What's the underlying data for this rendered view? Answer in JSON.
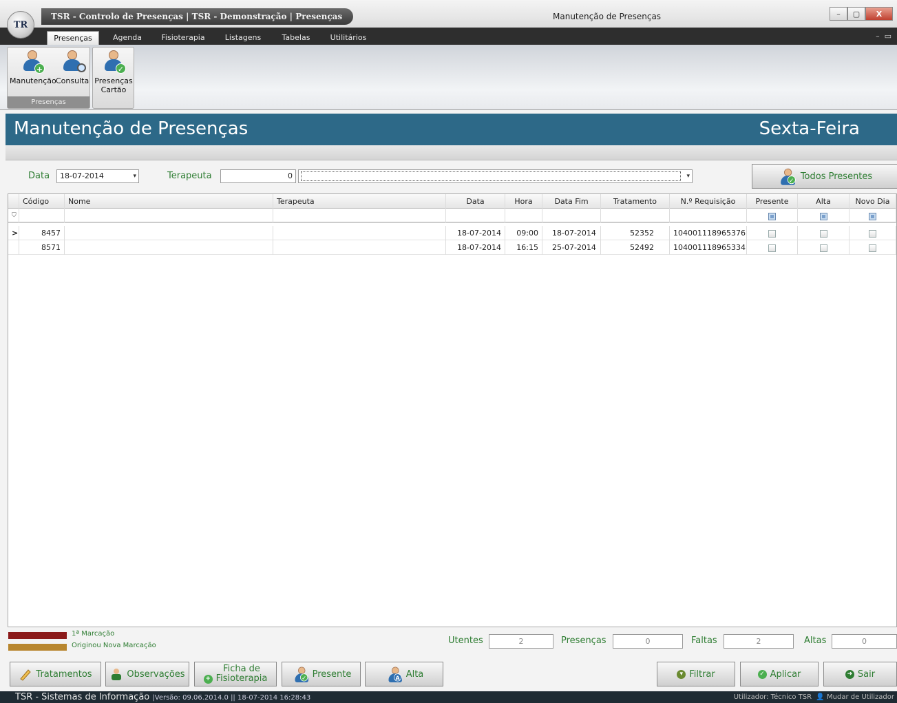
{
  "titlebar": {
    "logo": "TR",
    "app_title": "TSR - Controlo de Presenças  |  TSR - Demonstração  |  Presenças",
    "window_title": "Manutenção de Presenças"
  },
  "ribbon_tabs": [
    "Presenças",
    "Agenda",
    "Fisioterapia",
    "Listagens",
    "Tabelas",
    "Utilitários"
  ],
  "ribbon": {
    "manutencao": "Manutenção",
    "consulta": "Consulta",
    "presencas_cartao_1": "Presenças",
    "presencas_cartao_2": "Cartão",
    "group_label": "Presenças"
  },
  "page": {
    "title": "Manutenção de Presenças",
    "day": "Sexta-Feira"
  },
  "filters": {
    "data_label": "Data",
    "data_value": "18-07-2014",
    "terapeuta_label": "Terapeuta",
    "terapeuta_code": "0",
    "todos_presentes": "Todos Presentes"
  },
  "grid": {
    "columns": [
      "Código",
      "Nome",
      "Terapeuta",
      "Data",
      "Hora",
      "Data Fim",
      "Tratamento",
      "N.º Requisição",
      "Presente",
      "Alta",
      "Novo Dia"
    ],
    "rows": [
      {
        "codigo": "8457",
        "nome": "",
        "terapeuta": "",
        "data": "18-07-2014",
        "hora": "09:00",
        "data_fim": "18-07-2014",
        "tratamento": "52352",
        "requisicao": "104001118965376...",
        "presente": false,
        "alta": false,
        "novo_dia": false
      },
      {
        "codigo": "8571",
        "nome": "",
        "terapeuta": "",
        "data": "18-07-2014",
        "hora": "16:15",
        "data_fim": "25-07-2014",
        "tratamento": "52492",
        "requisicao": "104001118965334...",
        "presente": false,
        "alta": false,
        "novo_dia": false
      }
    ]
  },
  "legend": {
    "first": "1ª Marcação",
    "first_color": "#8b1a1a",
    "second": "Originou Nova Marcação",
    "second_color": "#b8862e"
  },
  "counters": {
    "utentes_label": "Utentes",
    "utentes": "2",
    "presencas_label": "Presenças",
    "presencas": "0",
    "faltas_label": "Faltas",
    "faltas": "2",
    "altas_label": "Altas",
    "altas": "0"
  },
  "buttons": {
    "tratamentos": "Tratamentos",
    "observacoes": "Observações",
    "ficha_1": "Ficha de",
    "ficha_2": "Fisioterapia",
    "presente": "Presente",
    "alta": "Alta",
    "filtrar": "Filtrar",
    "aplicar": "Aplicar",
    "sair": "Sair"
  },
  "statusbar": {
    "app": "TSR - Sistemas de Informação",
    "version": "|Versão:  09.06.2014.0 || 18-07-2014 16:28:43",
    "user": "Utilizador:  Técnico TSR",
    "change_user": "Mudar de Utilizador"
  },
  "colors": {
    "header_bg": "#2d6988",
    "label_green": "#2e7d32"
  }
}
